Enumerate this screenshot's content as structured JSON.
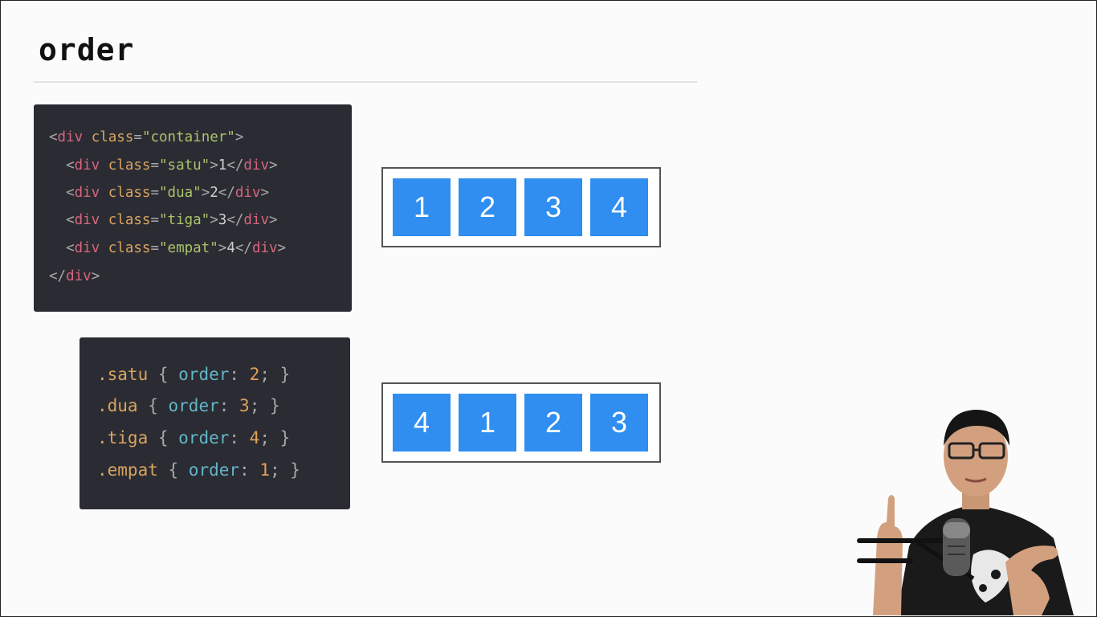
{
  "slide": {
    "title": "order"
  },
  "html_code": {
    "lines": [
      [
        {
          "t": "<",
          "c": "punc"
        },
        {
          "t": "div",
          "c": "tag"
        },
        {
          "t": " ",
          "c": "txt"
        },
        {
          "t": "class",
          "c": "attr"
        },
        {
          "t": "=",
          "c": "punc"
        },
        {
          "t": "\"container\"",
          "c": "str"
        },
        {
          "t": ">",
          "c": "punc"
        }
      ],
      [
        {
          "t": "  <",
          "c": "punc"
        },
        {
          "t": "div",
          "c": "tag"
        },
        {
          "t": " ",
          "c": "txt"
        },
        {
          "t": "class",
          "c": "attr"
        },
        {
          "t": "=",
          "c": "punc"
        },
        {
          "t": "\"satu\"",
          "c": "str"
        },
        {
          "t": ">",
          "c": "punc"
        },
        {
          "t": "1",
          "c": "txt"
        },
        {
          "t": "</",
          "c": "punc"
        },
        {
          "t": "div",
          "c": "tag"
        },
        {
          "t": ">",
          "c": "punc"
        }
      ],
      [
        {
          "t": "  <",
          "c": "punc"
        },
        {
          "t": "div",
          "c": "tag"
        },
        {
          "t": " ",
          "c": "txt"
        },
        {
          "t": "class",
          "c": "attr"
        },
        {
          "t": "=",
          "c": "punc"
        },
        {
          "t": "\"dua\"",
          "c": "str"
        },
        {
          "t": ">",
          "c": "punc"
        },
        {
          "t": "2",
          "c": "txt"
        },
        {
          "t": "</",
          "c": "punc"
        },
        {
          "t": "div",
          "c": "tag"
        },
        {
          "t": ">",
          "c": "punc"
        }
      ],
      [
        {
          "t": "  <",
          "c": "punc"
        },
        {
          "t": "div",
          "c": "tag"
        },
        {
          "t": " ",
          "c": "txt"
        },
        {
          "t": "class",
          "c": "attr"
        },
        {
          "t": "=",
          "c": "punc"
        },
        {
          "t": "\"tiga\"",
          "c": "str"
        },
        {
          "t": ">",
          "c": "punc"
        },
        {
          "t": "3",
          "c": "txt"
        },
        {
          "t": "</",
          "c": "punc"
        },
        {
          "t": "div",
          "c": "tag"
        },
        {
          "t": ">",
          "c": "punc"
        }
      ],
      [
        {
          "t": "  <",
          "c": "punc"
        },
        {
          "t": "div",
          "c": "tag"
        },
        {
          "t": " ",
          "c": "txt"
        },
        {
          "t": "class",
          "c": "attr"
        },
        {
          "t": "=",
          "c": "punc"
        },
        {
          "t": "\"empat\"",
          "c": "str"
        },
        {
          "t": ">",
          "c": "punc"
        },
        {
          "t": "4",
          "c": "txt"
        },
        {
          "t": "</",
          "c": "punc"
        },
        {
          "t": "div",
          "c": "tag"
        },
        {
          "t": ">",
          "c": "punc"
        }
      ],
      [
        {
          "t": "</",
          "c": "punc"
        },
        {
          "t": "div",
          "c": "tag"
        },
        {
          "t": ">",
          "c": "punc"
        }
      ]
    ]
  },
  "css_code": {
    "lines": [
      [
        {
          "t": ".satu",
          "c": "sel"
        },
        {
          "t": " { ",
          "c": "punc"
        },
        {
          "t": "order",
          "c": "prop"
        },
        {
          "t": ": ",
          "c": "punc"
        },
        {
          "t": "2",
          "c": "num"
        },
        {
          "t": "; }",
          "c": "punc"
        }
      ],
      [
        {
          "t": ".dua",
          "c": "sel"
        },
        {
          "t": " { ",
          "c": "punc"
        },
        {
          "t": "order",
          "c": "prop"
        },
        {
          "t": ": ",
          "c": "punc"
        },
        {
          "t": "3",
          "c": "num"
        },
        {
          "t": "; }",
          "c": "punc"
        }
      ],
      [
        {
          "t": ".tiga",
          "c": "sel"
        },
        {
          "t": " { ",
          "c": "punc"
        },
        {
          "t": "order",
          "c": "prop"
        },
        {
          "t": ": ",
          "c": "punc"
        },
        {
          "t": "4",
          "c": "num"
        },
        {
          "t": "; }",
          "c": "punc"
        }
      ],
      [
        {
          "t": ".empat",
          "c": "sel"
        },
        {
          "t": " { ",
          "c": "punc"
        },
        {
          "t": "order",
          "c": "prop"
        },
        {
          "t": ": ",
          "c": "punc"
        },
        {
          "t": "1",
          "c": "num"
        },
        {
          "t": "; }",
          "c": "punc"
        }
      ]
    ]
  },
  "demo_normal": {
    "boxes": [
      "1",
      "2",
      "3",
      "4"
    ]
  },
  "demo_ordered": {
    "boxes": [
      "4",
      "1",
      "2",
      "3"
    ]
  },
  "colors": {
    "box_blue": "#2f8ef0",
    "code_bg": "#2b2c33"
  }
}
